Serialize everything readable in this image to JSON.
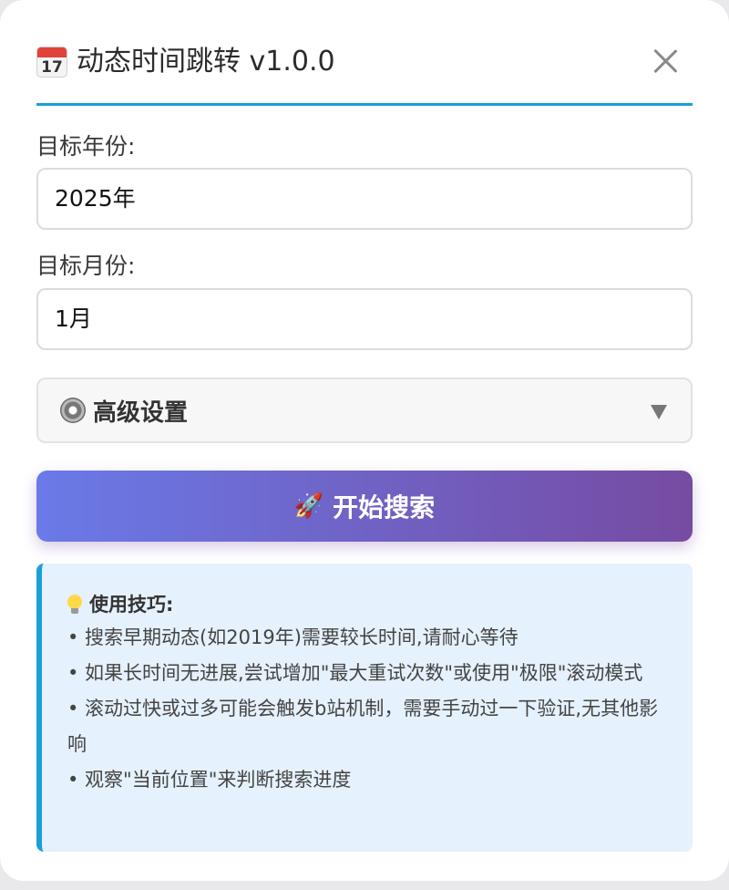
{
  "dialog": {
    "title": "动态时间跳转 v1.0.0",
    "calendar_icon_day": "17",
    "icon": "calendar-icon",
    "close_icon": "close-icon"
  },
  "year": {
    "label": "目标年份:",
    "value": "2025年"
  },
  "month": {
    "label": "目标月份:",
    "value": "1月"
  },
  "advanced": {
    "label": "高级设置",
    "icon": "gear-icon",
    "indicator": "▼"
  },
  "start_button": {
    "label": "开始搜索",
    "icon": "rocket-icon",
    "glyph": "🚀"
  },
  "tips": {
    "title": "使用技巧:",
    "icon": "lightbulb-icon",
    "items": [
      "• 搜索早期动态(如2019年)需要较长时间,请耐心等待",
      "• 如果长时间无进展,尝试增加\"最大重试次数\"或使用\"极限\"滚动模式",
      "• 滚动过快或过多可能会触发b站机制，需要手动过一下验证,无其他影响",
      "• 观察\"当前位置\"来判断搜索进度"
    ]
  },
  "colors": {
    "accent": "#1a9fd8",
    "button_start": "#6a7ae8",
    "button_end": "#764ba2",
    "tips_bg": "#e5f1fc"
  }
}
